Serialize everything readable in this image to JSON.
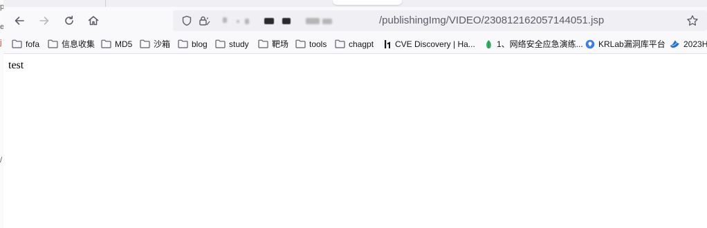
{
  "left_strip": {
    "chars": [
      "p",
      "e",
      "j",
      "/"
    ]
  },
  "navigation": {
    "back_icon": "arrow-left-icon",
    "forward_icon": "arrow-right-icon",
    "reload_icon": "reload-icon",
    "home_icon": "home-icon"
  },
  "urlbar": {
    "url_visible": "/publishingImg/VIDEO/230812162057144051.jsp",
    "host_redacted": true,
    "shield_icon": "shield-icon",
    "lock_icon": "lock-icon",
    "star_icon": "star-icon"
  },
  "bookmarks": [
    {
      "label": "fofa",
      "icon": "folder-icon"
    },
    {
      "label": "信息收集",
      "icon": "folder-icon"
    },
    {
      "label": "MD5",
      "icon": "folder-icon"
    },
    {
      "label": "沙箱",
      "icon": "folder-icon"
    },
    {
      "label": "blog",
      "icon": "folder-icon"
    },
    {
      "label": "study",
      "icon": "folder-icon"
    },
    {
      "label": "靶场",
      "icon": "folder-icon"
    },
    {
      "label": "tools",
      "icon": "folder-icon"
    },
    {
      "label": "chagpt",
      "icon": "folder-icon"
    },
    {
      "label": "CVE Discovery | Ha...",
      "icon": "h1-logo-icon"
    },
    {
      "label": "1、网络安全应急演练...",
      "icon": "leaf-favicon-icon"
    },
    {
      "label": "KRLab漏洞库平台",
      "icon": "krlab-favicon-icon"
    },
    {
      "label": "2023H",
      "icon": "blue-favicon-icon"
    }
  ],
  "page": {
    "body_text": "test"
  },
  "colors": {
    "toolbar_bg": "#f9f9fb",
    "urlbar_bg": "#f0f0f4",
    "icon": "#5b5b66"
  }
}
